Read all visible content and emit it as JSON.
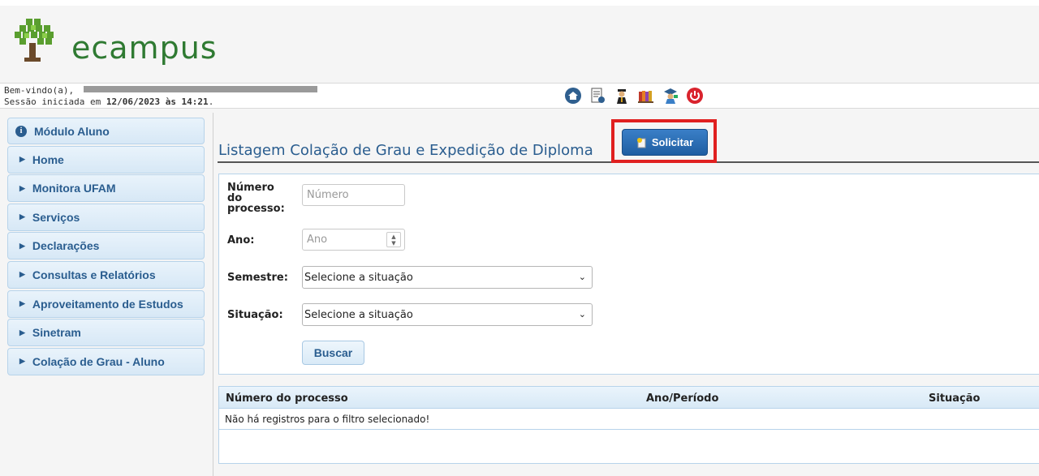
{
  "app": {
    "logo_text": "ecampus"
  },
  "session": {
    "welcome": "Bem-vindo(a),",
    "session_prefix": "Sessão iniciada em",
    "session_datetime": "12/06/2023 às 14:21",
    "session_suffix": "."
  },
  "quick_icons": [
    "home-icon",
    "document-icon",
    "graduate-icon",
    "books-icon",
    "teacher-icon",
    "power-icon"
  ],
  "sidebar": {
    "header": "Módulo Aluno",
    "items": [
      {
        "label": "Home"
      },
      {
        "label": "Monitora UFAM"
      },
      {
        "label": "Serviços"
      },
      {
        "label": "Declarações"
      },
      {
        "label": "Consultas e Relatórios"
      },
      {
        "label": "Aproveitamento de Estudos"
      },
      {
        "label": "Sinetram"
      },
      {
        "label": "Colação de Grau - Aluno"
      }
    ]
  },
  "main": {
    "title": "Listagem Colação de Grau e Expedição de Diploma",
    "solicitar_label": "Solicitar",
    "filters": {
      "numero_label_1": "Número",
      "numero_label_2": "do",
      "numero_label_3": "processo:",
      "numero_placeholder": "Número",
      "ano_label": "Ano:",
      "ano_placeholder": "Ano",
      "semestre_label": "Semestre:",
      "semestre_value": "Selecione a situação",
      "situacao_label": "Situação:",
      "situacao_value": "Selecione a situação",
      "buscar_label": "Buscar"
    },
    "results": {
      "columns": [
        "Número do processo",
        "Ano/Período",
        "Situação"
      ],
      "empty_message": "Não há registros para o filtro selecionado!"
    }
  }
}
